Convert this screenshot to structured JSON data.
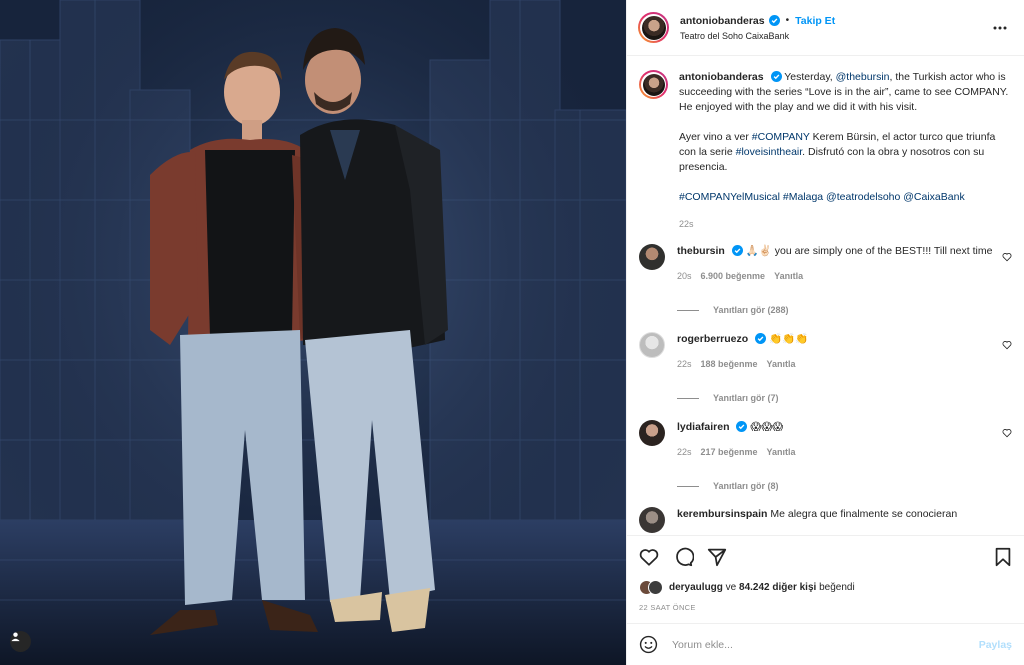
{
  "post": {
    "author": "antoniobanderas",
    "follow_label": "Takip Et",
    "separator": "•",
    "location": "Teatro del Soho CaixaBank",
    "more_icon": "more-horizontal-icon"
  },
  "caption": {
    "username": "antoniobanderas",
    "p1_pre": "Yesterday, ",
    "p1_mention": "@thebursin",
    "p1_post": ", the Turkish actor who is succeeding with the series “Love is in the air”, came to see COMPANY. He enjoyed with the play and we did it with his visit.",
    "p2_pre": "Ayer vino a ver ",
    "p2_tag1": "#COMPANY",
    "p2_mid": " Kerem Bürsin, el actor turco que triunfa con la serie ",
    "p2_tag2": "#loveisintheair",
    "p2_post": ". Disfrutó con la obra y nosotros con su presencia.",
    "tags": "#COMPANYelMusical #Malaga @teatrodelsoho @CaixaBank",
    "time": "22s"
  },
  "comments": [
    {
      "username": "thebursin",
      "text": "🙏🏻✌🏻 you are simply one of the BEST!!! Till next time",
      "time": "20s",
      "likes": "6.900 beğenme",
      "reply": "Yanıtla",
      "replies": "Yanıtları gör (288)"
    },
    {
      "username": "rogerberruezo",
      "text": "👏👏👏",
      "time": "22s",
      "likes": "188 beğenme",
      "reply": "Yanıtla",
      "replies": "Yanıtları gör (7)"
    },
    {
      "username": "lydiafairen",
      "text": "😱😱😱",
      "time": "22s",
      "likes": "217 beğenme",
      "reply": "Yanıtla",
      "replies": "Yanıtları gör (8)"
    },
    {
      "username": "kerembursinspain",
      "text": "Me alegra que finalmente se conocieran"
    }
  ],
  "likes": {
    "first_user": "deryaulugg",
    "conjunction": " ve ",
    "count_text": "84.242 diğer kişi",
    "suffix": " beğendi"
  },
  "timestamp": "22 SAAT ÖNCE",
  "add_comment": {
    "placeholder": "Yorum ekle...",
    "share_label": "Paylaş"
  },
  "icons": [
    "heart-icon",
    "comment-icon",
    "share-icon",
    "bookmark-icon",
    "emoji-icon",
    "user-tag-icon"
  ],
  "colors": {
    "accent": "#0095f6",
    "link": "#00376b",
    "muted": "#8e8e8e",
    "share_disabled": "#b2dffc"
  }
}
